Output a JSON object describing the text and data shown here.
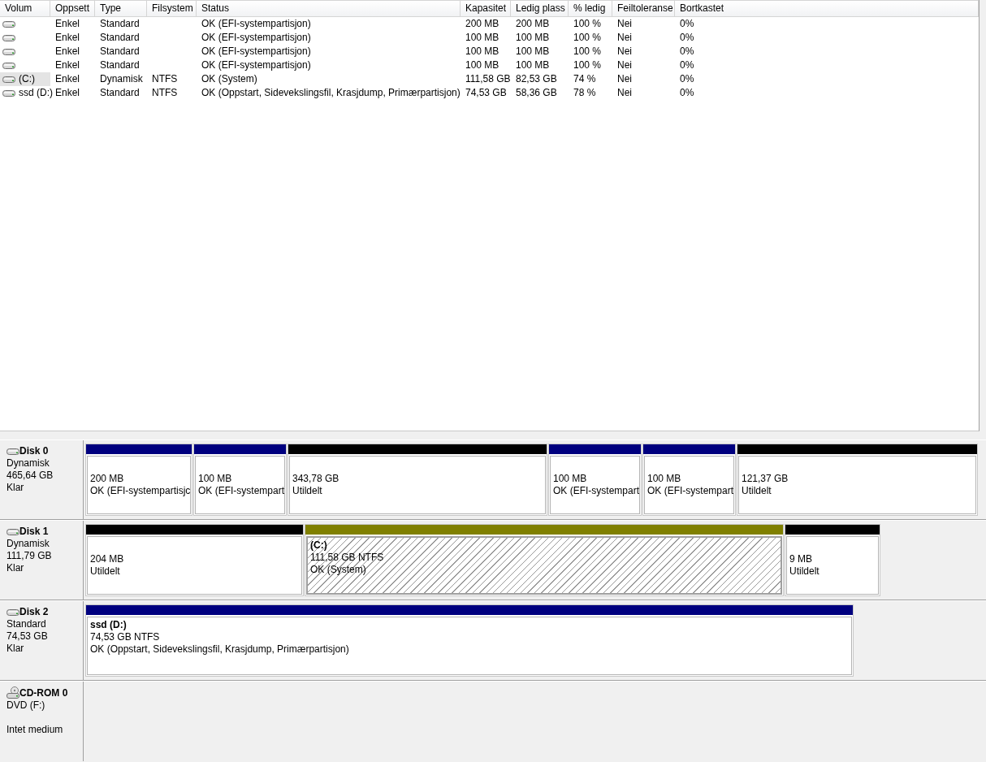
{
  "volume_list": {
    "columns": [
      "Volum",
      "Oppsett",
      "Type",
      "Filsystem",
      "Status",
      "Kapasitet",
      "Ledig plass",
      "% ledig",
      "Feiltoleranse",
      "Bortkastet"
    ],
    "rows": [
      {
        "selected": false,
        "cells": [
          "",
          "Enkel",
          "Standard",
          "",
          "OK (EFI-systempartisjon)",
          "200 MB",
          "200 MB",
          "100 %",
          "Nei",
          "0%"
        ]
      },
      {
        "selected": false,
        "cells": [
          "",
          "Enkel",
          "Standard",
          "",
          "OK (EFI-systempartisjon)",
          "100 MB",
          "100 MB",
          "100 %",
          "Nei",
          "0%"
        ]
      },
      {
        "selected": false,
        "cells": [
          "",
          "Enkel",
          "Standard",
          "",
          "OK (EFI-systempartisjon)",
          "100 MB",
          "100 MB",
          "100 %",
          "Nei",
          "0%"
        ]
      },
      {
        "selected": false,
        "cells": [
          "",
          "Enkel",
          "Standard",
          "",
          "OK (EFI-systempartisjon)",
          "100 MB",
          "100 MB",
          "100 %",
          "Nei",
          "0%"
        ]
      },
      {
        "selected": true,
        "cells": [
          "(C:)",
          "Enkel",
          "Dynamisk",
          "NTFS",
          "OK (System)",
          "111,58 GB",
          "82,53 GB",
          "74 %",
          "Nei",
          "0%"
        ]
      },
      {
        "selected": false,
        "cells": [
          "ssd (D:)",
          "Enkel",
          "Standard",
          "NTFS",
          "OK (Oppstart, Sidevekslingsfil, Krasjdump, Primærpartisjon)",
          "74,53 GB",
          "58,36 GB",
          "78 %",
          "Nei",
          "0%"
        ]
      }
    ]
  },
  "disks": [
    {
      "kind": "disk",
      "name": "Disk 0",
      "type": "Dynamisk",
      "size": "465,64 GB",
      "status": "Klar",
      "partitions": [
        {
          "kind": "primary",
          "selected": false,
          "size": "200 MB",
          "status": "OK (EFI-systempartisjc"
        },
        {
          "kind": "primary",
          "selected": false,
          "size": "100 MB",
          "status": "OK (EFI-systempart"
        },
        {
          "kind": "unallocated",
          "selected": false,
          "size": "343,78 GB",
          "status": "Utildelt"
        },
        {
          "kind": "primary",
          "selected": false,
          "size": "100 MB",
          "status": "OK (EFI-systempart"
        },
        {
          "kind": "primary",
          "selected": false,
          "size": "100 MB",
          "status": "OK (EFI-systempart"
        },
        {
          "kind": "unallocated",
          "selected": false,
          "size": "121,37 GB",
          "status": "Utildelt"
        }
      ]
    },
    {
      "kind": "disk",
      "name": "Disk 1",
      "type": "Dynamisk",
      "size": "111,79 GB",
      "status": "Klar",
      "partitions": [
        {
          "kind": "unallocated",
          "selected": false,
          "size": "204 MB",
          "status": "Utildelt"
        },
        {
          "kind": "simple",
          "selected": true,
          "name": "(C:)",
          "size": "111,58 GB NTFS",
          "status": "OK (System)"
        },
        {
          "kind": "unallocated",
          "selected": false,
          "size": "9 MB",
          "status": "Utildelt"
        }
      ]
    },
    {
      "kind": "disk",
      "name": "Disk 2",
      "type": "Standard",
      "size": "74,53 GB",
      "status": "Klar",
      "partitions": [
        {
          "kind": "primary",
          "selected": false,
          "name": "ssd  (D:)",
          "size": "74,53 GB NTFS",
          "status": "OK (Oppstart, Sidevekslingsfil, Krasjdump, Primærpartisjon)"
        }
      ]
    },
    {
      "kind": "cdrom",
      "name": "CD-ROM 0",
      "type": "DVD (F:)",
      "status": "Intet medium"
    }
  ]
}
